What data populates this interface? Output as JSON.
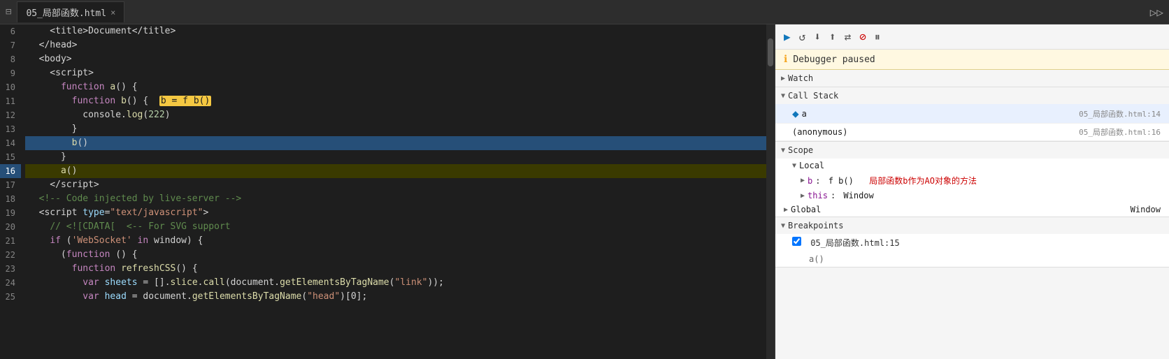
{
  "tab": {
    "label": "05_局部函数.html",
    "close_label": "×"
  },
  "toolbar": {
    "icons": [
      "⊞",
      "▷",
      "⟳",
      "↓",
      "↑",
      "⇄",
      "✎/",
      "⏸"
    ]
  },
  "code": {
    "lines": [
      {
        "num": 6,
        "content_html": "    &lt;title&gt;Document&lt;/title&gt;",
        "highlight": false,
        "breakpoint": false
      },
      {
        "num": 7,
        "content_html": "  &lt;/head&gt;",
        "highlight": false,
        "breakpoint": false
      },
      {
        "num": 8,
        "content_html": "  &lt;body&gt;",
        "highlight": false,
        "breakpoint": false
      },
      {
        "num": 9,
        "content_html": "    &lt;script&gt;",
        "highlight": false,
        "breakpoint": false
      },
      {
        "num": 10,
        "content_html": "      <span class='tok-keyword'>function</span> <span class='tok-fn'>a</span>() {",
        "highlight": false,
        "breakpoint": false
      },
      {
        "num": 11,
        "content_html": "        <span class='tok-keyword'>function</span> <span class='tok-fn'>b</span>() {  <span class='tok-highlight'>b = f b()</span>",
        "highlight": false,
        "breakpoint": false
      },
      {
        "num": 12,
        "content_html": "          console.<span class='tok-fn'>log</span>(<span class='tok-num'>222</span>)",
        "highlight": false,
        "breakpoint": false
      },
      {
        "num": 13,
        "content_html": "        }",
        "highlight": false,
        "breakpoint": false
      },
      {
        "num": 14,
        "content_html": "        <span class='tok-fn'>b</span>()",
        "highlight": true,
        "breakpoint": false
      },
      {
        "num": 15,
        "content_html": "      }",
        "highlight": false,
        "breakpoint": false
      },
      {
        "num": 16,
        "content_html": "      <span class='tok-fn'>a</span>()",
        "highlight": false,
        "breakpoint": true
      },
      {
        "num": 17,
        "content_html": "    &lt;/script&gt;",
        "highlight": false,
        "breakpoint": false
      },
      {
        "num": 18,
        "content_html": "  <span class='tok-comment'>&lt;!-- Code injected by live-server --&gt;</span>",
        "highlight": false,
        "breakpoint": false
      },
      {
        "num": 19,
        "content_html": "  &lt;script <span class='tok-attr'>type</span>=<span class='tok-string'>\"text/javascript\"</span>&gt;",
        "highlight": false,
        "breakpoint": false
      },
      {
        "num": 20,
        "content_html": "    <span class='tok-comment'>// &lt;![CDATA[  &lt;-- For SVG support</span>",
        "highlight": false,
        "breakpoint": false
      },
      {
        "num": 21,
        "content_html": "    <span class='tok-keyword'>if</span> (<span class='tok-string'>'WebSocket'</span> <span class='tok-keyword'>in</span> window) {",
        "highlight": false,
        "breakpoint": false
      },
      {
        "num": 22,
        "content_html": "      (<span class='tok-keyword'>function</span> () {",
        "highlight": false,
        "breakpoint": false
      },
      {
        "num": 23,
        "content_html": "        <span class='tok-keyword'>function</span> <span class='tok-fn'>refreshCSS</span>() {",
        "highlight": false,
        "breakpoint": false
      },
      {
        "num": 24,
        "content_html": "          <span class='tok-keyword'>var</span> <span class='tok-var'>sheets</span> = [].<span class='tok-fn'>slice</span>.<span class='tok-fn'>call</span>(document.<span class='tok-fn'>getElementsByTagName</span>(<span class='tok-string'>\"link\"</span>));",
        "highlight": false,
        "breakpoint": false
      },
      {
        "num": 25,
        "content_html": "          <span class='tok-keyword'>var</span> <span class='tok-var'>head</span> = document.<span class='tok-fn'>getElementsByTagName</span>(<span class='tok-string'>\"head\"</span>)[0];",
        "highlight": false,
        "breakpoint": false
      }
    ]
  },
  "debugger": {
    "paused_message": "Debugger paused",
    "sections": {
      "watch": {
        "label": "Watch",
        "collapsed": true
      },
      "call_stack": {
        "label": "Call Stack",
        "items": [
          {
            "name": "a",
            "location": "05_局部函数.html:14",
            "active": true
          },
          {
            "name": "(anonymous)",
            "location": "05_局部函数.html:16",
            "active": false
          }
        ]
      },
      "scope": {
        "label": "Scope",
        "local_label": "Local",
        "items": [
          {
            "key": "b",
            "value": "f b()",
            "comment": "局部函数b作为AO对象的方法",
            "expandable": true
          },
          {
            "key": "this",
            "value": "Window",
            "expandable": true
          }
        ],
        "global_label": "Global",
        "global_value": "Window"
      },
      "breakpoints": {
        "label": "Breakpoints",
        "items": [
          {
            "file": "05_局部函数.html:15",
            "code": "a()",
            "checked": true
          }
        ]
      }
    }
  }
}
